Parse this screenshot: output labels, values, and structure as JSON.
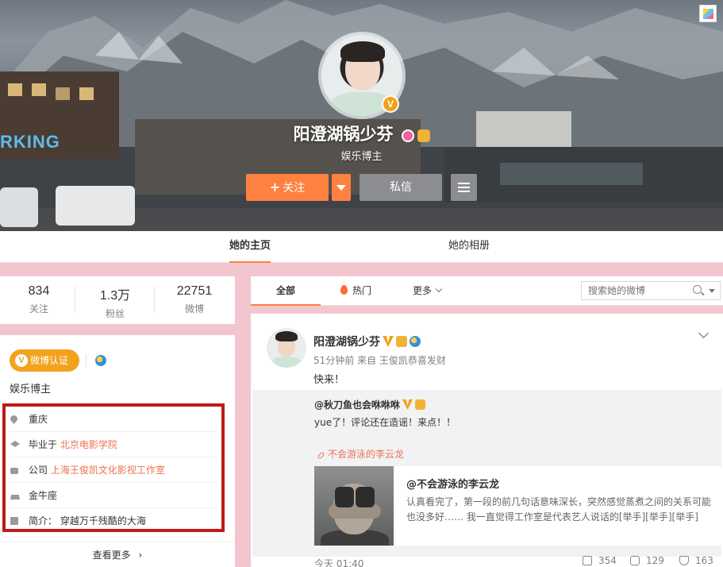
{
  "profile": {
    "name": "阳澄湖锅少芬",
    "subtitle": "娱乐博主",
    "buttons": {
      "follow": "关注",
      "follow_plus": "+",
      "message": "私信"
    }
  },
  "cover_sign_text": "RKING",
  "tabs": [
    "她的主页",
    "她的相册"
  ],
  "stats": [
    {
      "value": "834",
      "label": "关注"
    },
    {
      "value": "1.3万",
      "label": "粉丝"
    },
    {
      "value": "22751",
      "label": "微博"
    }
  ],
  "info": {
    "verify_label": "微博认证",
    "verify_icon": "V",
    "intro_short": "娱乐博主",
    "rows": [
      {
        "icon": "location-icon",
        "prefix": "重庆",
        "highlight": ""
      },
      {
        "icon": "graduation-cap-icon",
        "prefix": "毕业于 ",
        "highlight": "北京电影学院"
      },
      {
        "icon": "briefcase-icon",
        "prefix": "公司 ",
        "highlight": "上海王俊凯文化影视工作室"
      },
      {
        "icon": "birthday-cake-icon",
        "prefix": "金牛座",
        "highlight": ""
      },
      {
        "icon": "pencil-icon",
        "prefix": "简介：  穿越万千残酷的大海",
        "highlight": ""
      }
    ],
    "see_more": "查看更多",
    "see_more_arrow": "›"
  },
  "feed": {
    "tabs": {
      "all": "全部",
      "hot": "热门",
      "more": "更多"
    },
    "search_placeholder": "搜索她的微博"
  },
  "post": {
    "author": "阳澄湖锅少芬",
    "meta": "51分钟前  来自 王俊凯恭喜发财",
    "text": "快来！",
    "repost": {
      "author": "@秋刀鱼也会咻咻咻",
      "text": "yue了！评论还在造谣！来点！！",
      "tag": "不会游泳的李云龙",
      "card_title": "@不会游泳的李云龙",
      "card_body": "认真看完了，第一段的前几句话意味深长，突然感觉蒸煮之间的关系可能也没多好…… 我一直觉得工作室是代表艺人说话的[举手][举手][举手]",
      "time": "今天 01:40"
    },
    "actions": {
      "share": "354",
      "comment": "129",
      "like": "163"
    }
  },
  "colors": {
    "accent": "#ff8140",
    "link": "#eb7350",
    "verify": "#f3a21e",
    "page_bg": "#f2c6cf",
    "frame": "#be1a1a"
  }
}
